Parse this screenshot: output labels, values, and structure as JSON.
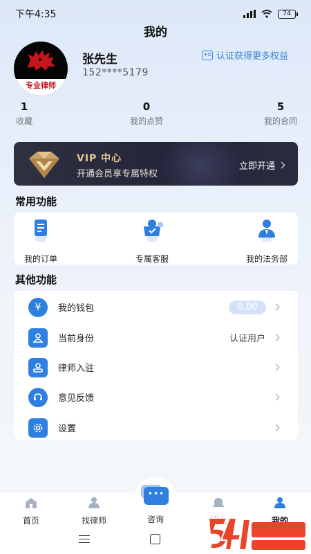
{
  "status_bar": {
    "time": "下午4:35",
    "battery": "74"
  },
  "page_title": "我的",
  "profile": {
    "avatar_caption": "专业律师",
    "name": "张先生",
    "phone": "152****5179",
    "verify_link": "认证获得更多权益"
  },
  "stats": [
    {
      "value": "1",
      "label": "收藏"
    },
    {
      "value": "0",
      "label": "我的点赞"
    },
    {
      "value": "5",
      "label": "我的合同"
    }
  ],
  "vip": {
    "title": "VIP 中心",
    "subtitle": "开通会员享专属特权",
    "button": "立即开通"
  },
  "common_functions": {
    "title": "常用功能",
    "items": [
      {
        "label": "我的订单",
        "icon": "order-icon"
      },
      {
        "label": "专属客服",
        "icon": "customer-service-icon"
      },
      {
        "label": "我的法务部",
        "icon": "legal-department-icon"
      }
    ]
  },
  "other_functions": {
    "title": "其他功能",
    "items": [
      {
        "label": "我的钱包",
        "value": "0.00",
        "icon": "wallet-icon",
        "glyph": "¥"
      },
      {
        "label": "当前身份",
        "value": "认证用户",
        "icon": "identity-icon"
      },
      {
        "label": "律师入驻",
        "value": "",
        "icon": "lawyer-join-icon"
      },
      {
        "label": "意见反馈",
        "value": "",
        "icon": "feedback-icon"
      },
      {
        "label": "设置",
        "value": "",
        "icon": "settings-icon"
      }
    ]
  },
  "tabs": [
    {
      "label": "首页",
      "icon": "home-icon"
    },
    {
      "label": "找律师",
      "icon": "find-lawyer-icon"
    },
    {
      "label": "咨询",
      "icon": "consult-icon"
    },
    {
      "label": "消息",
      "icon": "message-icon"
    },
    {
      "label": "我的",
      "icon": "profile-icon",
      "active": true
    }
  ],
  "colors": {
    "accent": "#2f7fe0",
    "vip_gold": "#e8c88e",
    "vip_bg": "#2a2b3f",
    "link": "#3a86d8"
  }
}
